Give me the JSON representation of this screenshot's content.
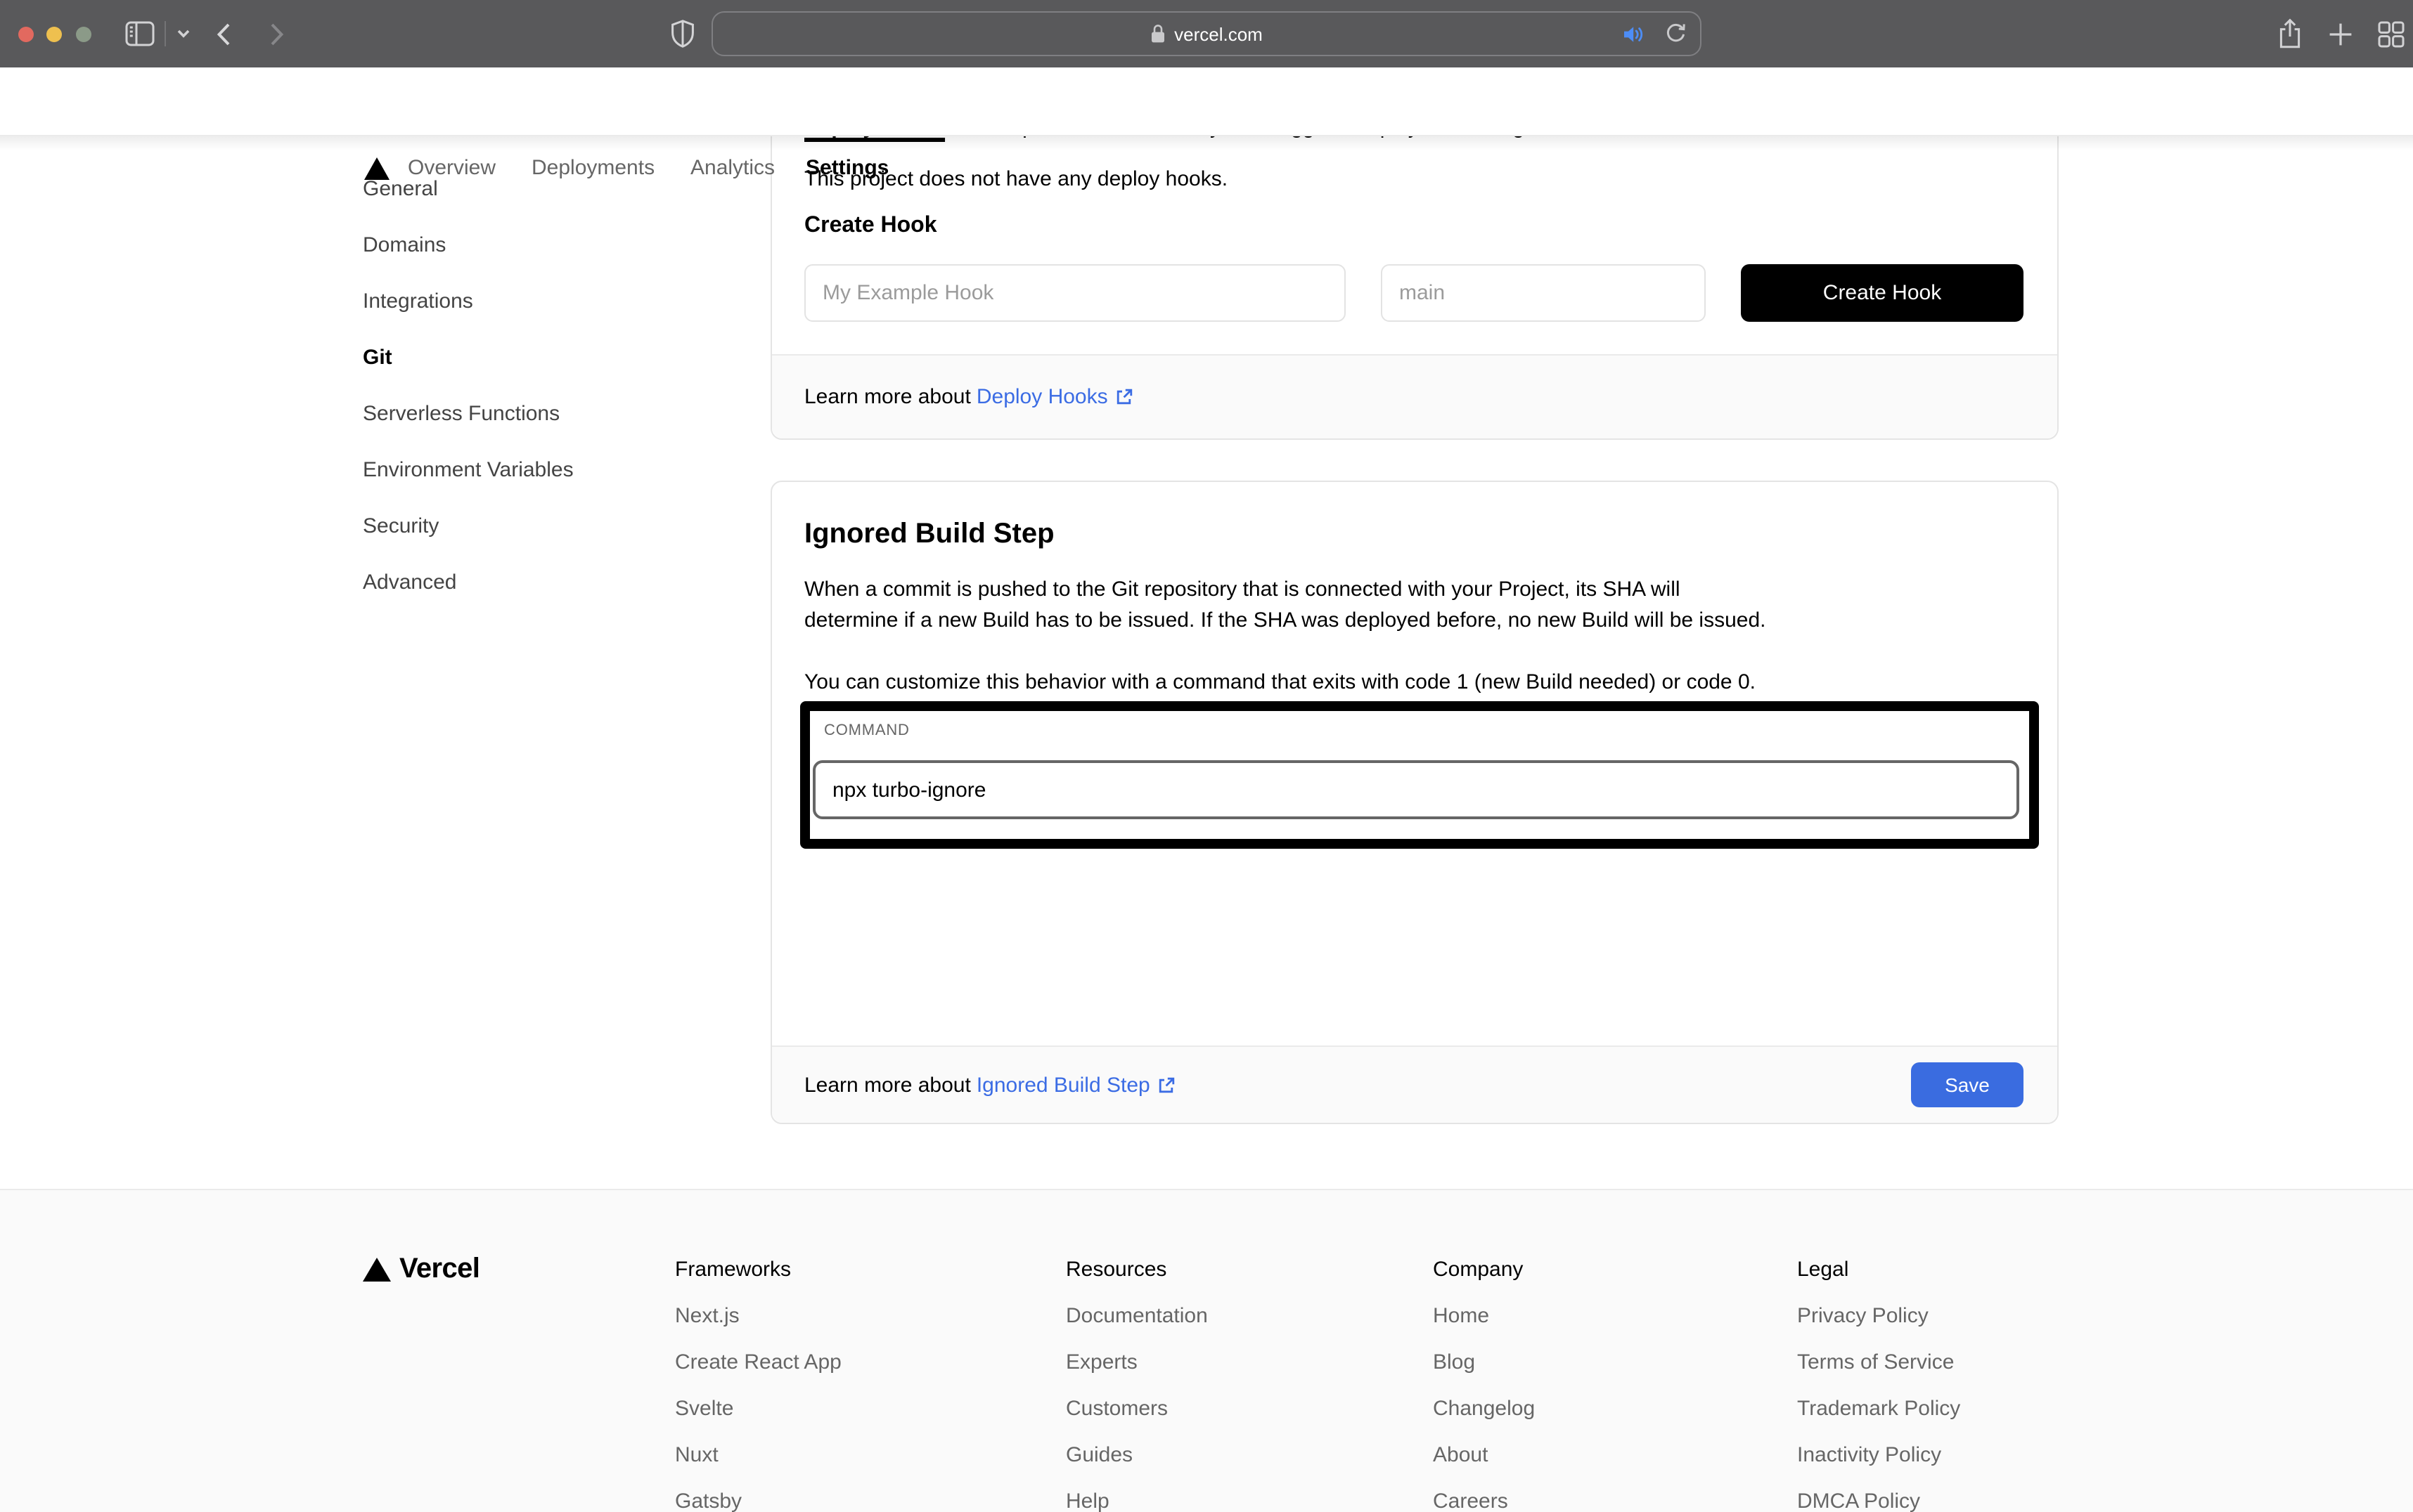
{
  "browser": {
    "url": "vercel.com",
    "icons": [
      "sidebar-toggle",
      "chevron-down",
      "back",
      "forward",
      "shield",
      "lock",
      "audio",
      "reload",
      "share",
      "new-tab",
      "tab-overview"
    ]
  },
  "nav": {
    "items": [
      "Overview",
      "Deployments",
      "Analytics",
      "Settings"
    ],
    "active": "Settings"
  },
  "sidebar": {
    "items": [
      "General",
      "Domains",
      "Integrations",
      "Git",
      "Serverless Functions",
      "Environment Variables",
      "Security",
      "Advanced"
    ],
    "active": "Git"
  },
  "cards": {
    "deploy_hooks": {
      "clipped_lead": "Deploy Hooks",
      "clipped_rest": " are unique URLs that allow you to trigger a deployment of a given branch.",
      "empty_state": "This project does not have any deploy hooks.",
      "create_heading": "Create Hook",
      "name_placeholder": "My Example Hook",
      "branch_placeholder": "main",
      "create_button": "Create Hook",
      "learn_prefix": "Learn more about",
      "learn_link": "Deploy Hooks"
    },
    "ignored_build_step": {
      "heading": "Ignored Build Step",
      "body_line1": "When a commit is pushed to the Git repository that is connected with your Project, its SHA will",
      "body_line2": "determine if a new Build has to be issued. If the SHA was deployed before, no new Build will be issued.",
      "body_line3": "You can customize this behavior with a command that exits with code 1 (new Build needed) or code 0.",
      "command_label": "COMMAND",
      "command_value": "npx turbo-ignore",
      "learn_prefix": "Learn more about",
      "learn_link": "Ignored Build Step",
      "save_button": "Save"
    }
  },
  "footer": {
    "brand": "Vercel",
    "columns": [
      {
        "title": "Frameworks",
        "links": [
          "Next.js",
          "Create React App",
          "Svelte",
          "Nuxt",
          "Gatsby"
        ]
      },
      {
        "title": "Resources",
        "links": [
          "Documentation",
          "Experts",
          "Customers",
          "Guides",
          "Help"
        ]
      },
      {
        "title": "Company",
        "links": [
          "Home",
          "Blog",
          "Changelog",
          "About",
          "Careers"
        ]
      },
      {
        "title": "Legal",
        "links": [
          "Privacy Policy",
          "Terms of Service",
          "Trademark Policy",
          "Inactivity Policy",
          "DMCA Policy"
        ]
      }
    ]
  },
  "colors": {
    "link_blue": "#3b6ce4",
    "save_blue": "#3a6ce0",
    "button_black": "#000000",
    "highlight_border": "#000000",
    "traffic_red": "#e2695f",
    "traffic_yellow": "#eec04f",
    "traffic_green": "#8b9a88",
    "toolbar_gray": "#59595b"
  }
}
